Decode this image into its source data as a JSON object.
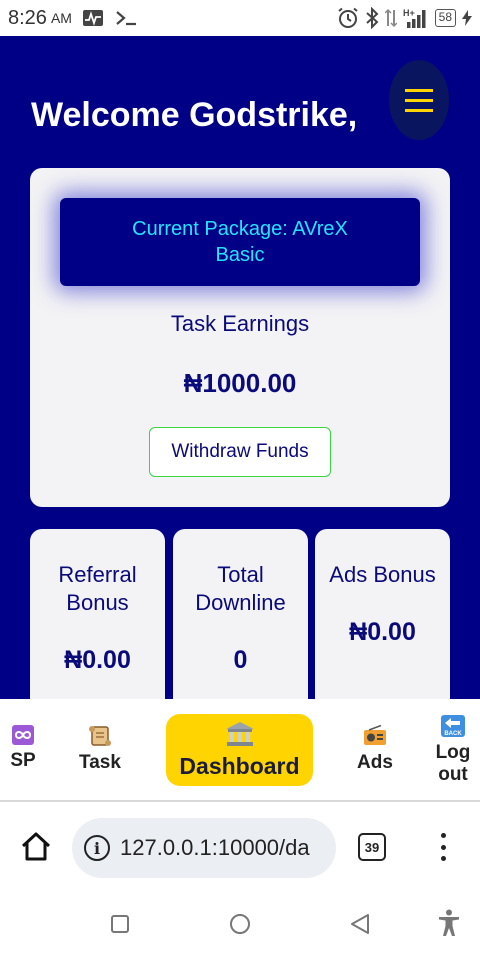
{
  "status_bar": {
    "time": "8:26",
    "ampm": "AM",
    "battery": "58"
  },
  "header": {
    "welcome": "Welcome Godstrike,"
  },
  "main_card": {
    "package": "Current Package: AVreX Basic",
    "task_label": "Task Earnings",
    "task_value": "₦1000.00",
    "withdraw_label": "Withdraw Funds"
  },
  "stats": [
    {
      "label": "Referral Bonus",
      "value": "₦0.00"
    },
    {
      "label": "Total Downline",
      "value": "0"
    },
    {
      "label": "Ads Bonus",
      "value": "₦0.00"
    }
  ],
  "bottom_nav": {
    "items": [
      {
        "label": "SP",
        "icon": "infinity-icon"
      },
      {
        "label": "Task",
        "icon": "scroll-icon"
      },
      {
        "label": "Dashboard",
        "icon": "bank-icon"
      },
      {
        "label": "Ads",
        "icon": "radio-icon"
      },
      {
        "label": "Log out",
        "icon": "back-arrow-icon"
      }
    ]
  },
  "browser": {
    "url": "127.0.0.1:10000/da",
    "tab_count": "39"
  },
  "colors": {
    "primary_bg": "#000087",
    "accent_yellow": "#ffd400",
    "package_text": "#26e4ff",
    "withdraw_border": "#39d63f"
  }
}
